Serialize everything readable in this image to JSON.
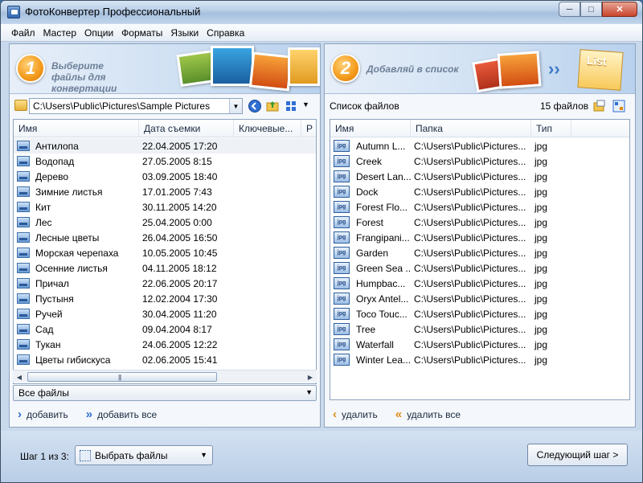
{
  "window": {
    "title": "ФотоКонвертер Профессиональный",
    "controls": {
      "minimize": "─",
      "maximize": "□",
      "close": "✕"
    }
  },
  "menu": [
    "Файл",
    "Мастер",
    "Опции",
    "Форматы",
    "Языки",
    "Справка"
  ],
  "left": {
    "step_number": "1",
    "banner_text": "Выберите файлы для конвертации",
    "path": "C:\\Users\\Public\\Pictures\\Sample Pictures",
    "columns": [
      "Имя",
      "Дата съемки",
      "Ключевые...",
      "Р"
    ],
    "files": [
      {
        "name": "Антилопа",
        "date": "22.04.2005 17:20"
      },
      {
        "name": "Водопад",
        "date": "27.05.2005 8:15"
      },
      {
        "name": "Дерево",
        "date": "03.09.2005 18:40"
      },
      {
        "name": "Зимние листья",
        "date": "17.01.2005 7:43"
      },
      {
        "name": "Кит",
        "date": "30.11.2005 14:20"
      },
      {
        "name": "Лес",
        "date": "25.04.2005 0:00"
      },
      {
        "name": "Лесные цветы",
        "date": "26.04.2005 16:50"
      },
      {
        "name": "Морская черепаха",
        "date": "10.05.2005 10:45"
      },
      {
        "name": "Осенние листья",
        "date": "04.11.2005 18:12"
      },
      {
        "name": "Причал",
        "date": "22.06.2005 20:17"
      },
      {
        "name": "Пустыня",
        "date": "12.02.2004 17:30"
      },
      {
        "name": "Ручей",
        "date": "30.04.2005 11:20"
      },
      {
        "name": "Сад",
        "date": "09.04.2004 8:17"
      },
      {
        "name": "Тукан",
        "date": "24.06.2005 12:22"
      },
      {
        "name": "Цветы гибискуса",
        "date": "02.06.2005 15:41"
      }
    ],
    "filter": "Все файлы",
    "add_label": "добавить",
    "add_all_label": "добавить все"
  },
  "right": {
    "step_number": "2",
    "banner_text": "Добавляй в список",
    "list_badge": "List",
    "list_title": "Список файлов",
    "file_count": "15 файлов",
    "columns": [
      "Имя",
      "Папка",
      "Тип"
    ],
    "files": [
      {
        "name": "Autumn L...",
        "folder": "C:\\Users\\Public\\Pictures...",
        "type": "jpg"
      },
      {
        "name": "Creek",
        "folder": "C:\\Users\\Public\\Pictures...",
        "type": "jpg"
      },
      {
        "name": "Desert Lan...",
        "folder": "C:\\Users\\Public\\Pictures...",
        "type": "jpg"
      },
      {
        "name": "Dock",
        "folder": "C:\\Users\\Public\\Pictures...",
        "type": "jpg"
      },
      {
        "name": "Forest Flo...",
        "folder": "C:\\Users\\Public\\Pictures...",
        "type": "jpg"
      },
      {
        "name": "Forest",
        "folder": "C:\\Users\\Public\\Pictures...",
        "type": "jpg"
      },
      {
        "name": "Frangipani...",
        "folder": "C:\\Users\\Public\\Pictures...",
        "type": "jpg"
      },
      {
        "name": "Garden",
        "folder": "C:\\Users\\Public\\Pictures...",
        "type": "jpg"
      },
      {
        "name": "Green Sea ...",
        "folder": "C:\\Users\\Public\\Pictures...",
        "type": "jpg"
      },
      {
        "name": "Humpbac...",
        "folder": "C:\\Users\\Public\\Pictures...",
        "type": "jpg"
      },
      {
        "name": "Oryx Antel...",
        "folder": "C:\\Users\\Public\\Pictures...",
        "type": "jpg"
      },
      {
        "name": "Toco Touc...",
        "folder": "C:\\Users\\Public\\Pictures...",
        "type": "jpg"
      },
      {
        "name": "Tree",
        "folder": "C:\\Users\\Public\\Pictures...",
        "type": "jpg"
      },
      {
        "name": "Waterfall",
        "folder": "C:\\Users\\Public\\Pictures...",
        "type": "jpg"
      },
      {
        "name": "Winter Lea...",
        "folder": "C:\\Users\\Public\\Pictures...",
        "type": "jpg"
      }
    ],
    "jpg_icon_text": "jpg",
    "remove_label": "удалить",
    "remove_all_label": "удалить все"
  },
  "footer": {
    "step_label": "Шаг 1 из 3:",
    "step_select": "Выбрать файлы",
    "next_button": "Следующий шаг >"
  },
  "colors": {
    "accent_orange": "#f39a1a",
    "accent_blue": "#2f6fd3",
    "panel_border": "#8ea4bf"
  }
}
